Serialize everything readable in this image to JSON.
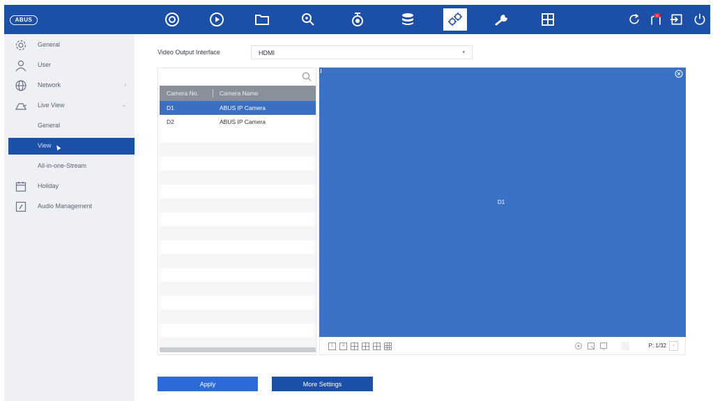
{
  "brand": {
    "logo": "ABUS"
  },
  "topbar": {
    "icons": [
      "live-view-icon",
      "playback-icon",
      "file-folder-icon",
      "smart-search-icon",
      "camera-icon",
      "storage-icon",
      "configuration-icon",
      "maintenance-icon",
      "layout-grid-icon"
    ],
    "active": "configuration-icon",
    "right_icons": [
      "refresh-icon",
      "alarm-notification-icon",
      "logout-icon",
      "power-icon"
    ],
    "badge": "!!"
  },
  "sidebar": {
    "items": [
      {
        "label": "General",
        "icon": "gear-icon"
      },
      {
        "label": "User",
        "icon": "user-icon"
      },
      {
        "label": "Network",
        "icon": "globe-icon",
        "chevron": "›"
      },
      {
        "label": "Live View",
        "icon": "live-view-icon",
        "chevron": "⌄"
      },
      {
        "label": "General"
      },
      {
        "label": "View",
        "selected": true
      },
      {
        "label": "All-in-one-Stream"
      },
      {
        "label": "Holiday",
        "icon": "calendar-icon"
      },
      {
        "label": "Audio Management",
        "icon": "audio-icon"
      }
    ]
  },
  "video_output": {
    "label": "Video Output Interface",
    "value": "HDMI"
  },
  "camera_list": {
    "columns": [
      "Camera No.",
      "Camera Name"
    ],
    "rows": [
      {
        "no": "D1",
        "name": "ABUS IP Camera",
        "selected": true
      },
      {
        "no": "D2",
        "name": "ABUS IP Camera",
        "selected": false
      }
    ]
  },
  "preview": {
    "channel": "D1"
  },
  "preview_toolbar": {
    "layout_buttons": [
      "1",
      "4",
      "6",
      "8",
      "9",
      "16"
    ],
    "page": "P: 1/32"
  },
  "buttons": {
    "apply": "Apply",
    "more_settings": "More Settings"
  },
  "colors": {
    "header": "#1c4fa8",
    "accent": "#2d6ad9",
    "preview": "#3a72c8"
  }
}
